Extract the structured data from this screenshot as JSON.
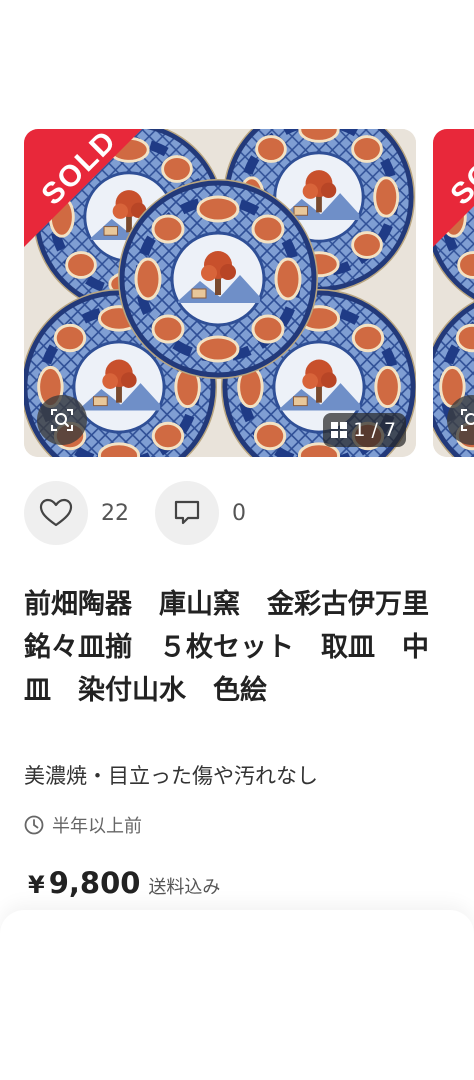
{
  "listing": {
    "sold_label": "SOLD",
    "image_counter": "1 / 7",
    "likes_count": "22",
    "comments_count": "0",
    "title": "前畑陶器　庫山窯　金彩古伊万里　銘々皿揃　５枚セット　取皿　中皿　染付山水　色絵",
    "subtitle": "美濃焼・目立った傷や汚れなし",
    "timestamp": "半年以上前",
    "price_currency": "¥",
    "price": "9,800",
    "shipping": "送料込み"
  },
  "icons": {
    "lens": "image-search-icon",
    "counter": "grid-icon",
    "like": "heart-icon",
    "comment": "comment-icon",
    "time": "clock-icon"
  },
  "colors": {
    "sold_ribbon": "#e8283a",
    "plate_blue": "#3f63a8",
    "plate_red": "#c9522f",
    "plate_gold": "#d2a24a"
  }
}
